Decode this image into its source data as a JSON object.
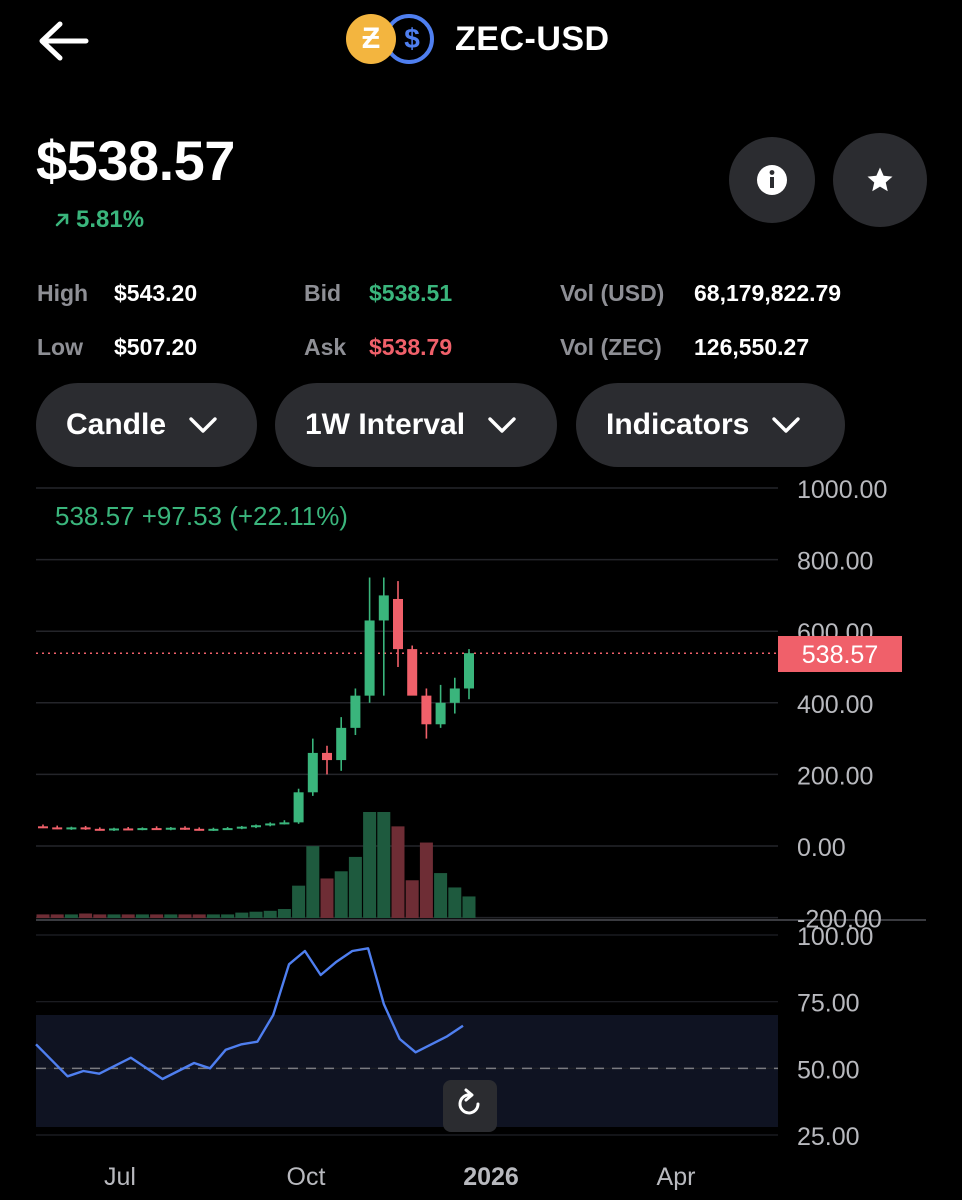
{
  "header": {
    "pair": "ZEC-USD",
    "base_coin_icon": "zec-coin-icon",
    "quote_coin_icon": "usd-coin-icon"
  },
  "price": {
    "value": "$538.57",
    "change": "5.81%"
  },
  "stats": {
    "high_label": "High",
    "high_value": "$543.20",
    "low_label": "Low",
    "low_value": "$507.20",
    "bid_label": "Bid",
    "bid_value": "$538.51",
    "ask_label": "Ask",
    "ask_value": "$538.79",
    "vol_usd_label": "Vol (USD)",
    "vol_usd_value": "68,179,822.79",
    "vol_zec_label": "Vol (ZEC)",
    "vol_zec_value": "126,550.27"
  },
  "controls": {
    "chart_type": "Candle",
    "interval": "1W Interval",
    "indicators": "Indicators"
  },
  "colors": {
    "up": "#3ab57c",
    "down": "#f0606a",
    "rsi": "#4f7ff0",
    "panel": "#2b2c30"
  },
  "chart_data": [
    {
      "type": "candlestick",
      "legend": "538.57  +97.53 (+22.11%)",
      "current_price_label": "538.57",
      "current_price": 538.57,
      "ylim": [
        -200,
        1000
      ],
      "y_ticks": [
        "1000.00",
        "800.00",
        "600.00",
        "400.00",
        "200.00",
        "0.00",
        "-200.00"
      ],
      "x_ticks": [
        "Jul",
        "Oct",
        "2026",
        "Apr"
      ],
      "candles": [
        {
          "o": 55,
          "h": 60,
          "l": 50,
          "c": 52
        },
        {
          "o": 52,
          "h": 57,
          "l": 47,
          "c": 49
        },
        {
          "o": 49,
          "h": 54,
          "l": 45,
          "c": 52
        },
        {
          "o": 52,
          "h": 56,
          "l": 45,
          "c": 48
        },
        {
          "o": 48,
          "h": 52,
          "l": 43,
          "c": 46
        },
        {
          "o": 46,
          "h": 51,
          "l": 42,
          "c": 49
        },
        {
          "o": 49,
          "h": 53,
          "l": 45,
          "c": 47
        },
        {
          "o": 47,
          "h": 52,
          "l": 44,
          "c": 50
        },
        {
          "o": 50,
          "h": 55,
          "l": 46,
          "c": 48
        },
        {
          "o": 48,
          "h": 53,
          "l": 44,
          "c": 51
        },
        {
          "o": 51,
          "h": 55,
          "l": 45,
          "c": 48
        },
        {
          "o": 48,
          "h": 52,
          "l": 43,
          "c": 45
        },
        {
          "o": 45,
          "h": 51,
          "l": 42,
          "c": 48
        },
        {
          "o": 48,
          "h": 53,
          "l": 45,
          "c": 50
        },
        {
          "o": 50,
          "h": 56,
          "l": 47,
          "c": 54
        },
        {
          "o": 54,
          "h": 60,
          "l": 50,
          "c": 58
        },
        {
          "o": 58,
          "h": 66,
          "l": 55,
          "c": 63
        },
        {
          "o": 63,
          "h": 72,
          "l": 60,
          "c": 66
        },
        {
          "o": 66,
          "h": 160,
          "l": 62,
          "c": 150
        },
        {
          "o": 150,
          "h": 300,
          "l": 140,
          "c": 260
        },
        {
          "o": 260,
          "h": 280,
          "l": 200,
          "c": 240
        },
        {
          "o": 240,
          "h": 360,
          "l": 210,
          "c": 330
        },
        {
          "o": 330,
          "h": 440,
          "l": 310,
          "c": 420
        },
        {
          "o": 420,
          "h": 750,
          "l": 400,
          "c": 630
        },
        {
          "o": 630,
          "h": 750,
          "l": 420,
          "c": 700
        },
        {
          "o": 690,
          "h": 740,
          "l": 500,
          "c": 550
        },
        {
          "o": 550,
          "h": 560,
          "l": 430,
          "c": 420
        },
        {
          "o": 420,
          "h": 440,
          "l": 300,
          "c": 340
        },
        {
          "o": 340,
          "h": 450,
          "l": 330,
          "c": 400
        },
        {
          "o": 400,
          "h": 470,
          "l": 370,
          "c": 440
        },
        {
          "o": 440,
          "h": 550,
          "l": 410,
          "c": 538.57
        }
      ],
      "volume": [
        4,
        4,
        4,
        5,
        4,
        4,
        4,
        4,
        4,
        4,
        4,
        4,
        4,
        4,
        6,
        7,
        8,
        10,
        36,
        80,
        44,
        52,
        68,
        118,
        118,
        102,
        42,
        84,
        50,
        34,
        24
      ]
    },
    {
      "type": "line",
      "ylim": [
        25,
        100
      ],
      "y_ticks": [
        "100.00",
        "75.00",
        "50.00",
        "25.00"
      ],
      "band": [
        50,
        70
      ],
      "midline": 50,
      "values": [
        59,
        53,
        47,
        49,
        48,
        51,
        54,
        50,
        46,
        49,
        52,
        50,
        57,
        59,
        60,
        70,
        89,
        94,
        85,
        90,
        94,
        95,
        74,
        61,
        56,
        59,
        62,
        66
      ]
    }
  ]
}
